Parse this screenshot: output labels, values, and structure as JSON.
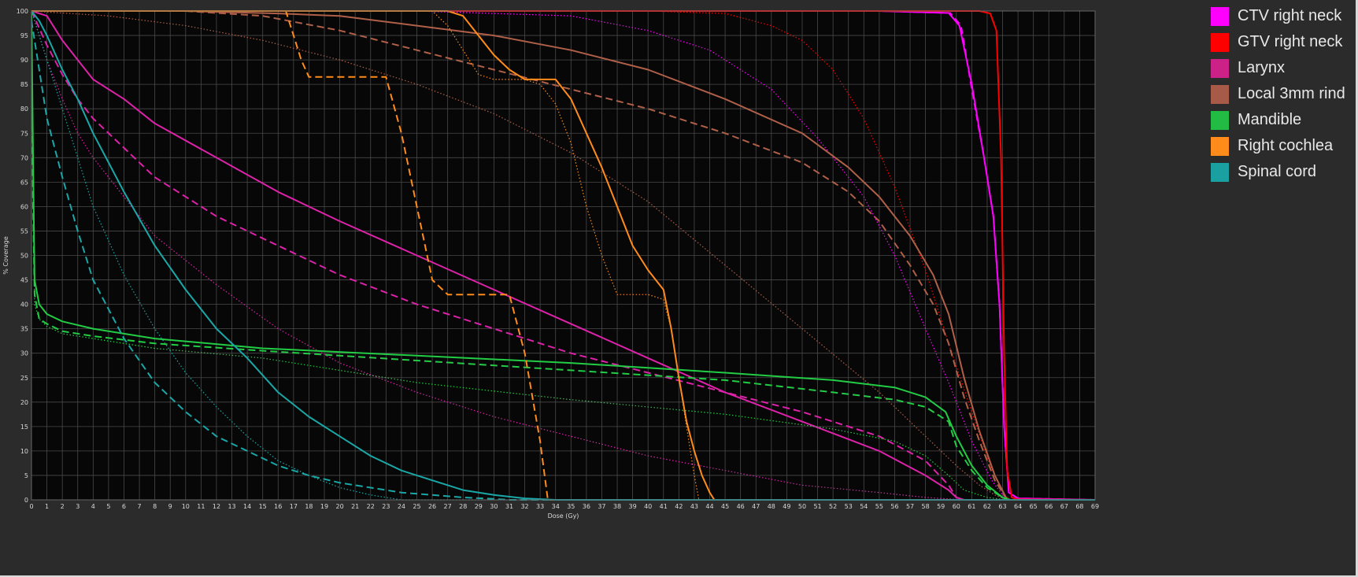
{
  "chart_data": {
    "type": "line",
    "title": "",
    "xlabel": "Dose (Gy)",
    "ylabel": "% Coverage",
    "xlim": [
      0,
      69
    ],
    "ylim": [
      0,
      100
    ],
    "x_ticks": [
      0,
      1,
      2,
      3,
      4,
      5,
      6,
      7,
      8,
      9,
      10,
      11,
      12,
      13,
      14,
      15,
      16,
      17,
      18,
      19,
      20,
      21,
      22,
      23,
      24,
      25,
      26,
      27,
      28,
      29,
      30,
      31,
      32,
      33,
      34,
      35,
      36,
      37,
      38,
      39,
      40,
      41,
      42,
      43,
      44,
      45,
      46,
      47,
      48,
      49,
      50,
      51,
      52,
      53,
      54,
      55,
      56,
      57,
      58,
      59,
      60,
      61,
      62,
      63,
      64,
      65,
      66,
      67,
      68,
      69
    ],
    "y_ticks": [
      0,
      5,
      10,
      15,
      20,
      25,
      30,
      35,
      40,
      45,
      50,
      55,
      60,
      65,
      70,
      75,
      80,
      85,
      90,
      95,
      100
    ],
    "grid": true,
    "legend_position": "right",
    "series": [
      {
        "name": "CTV right neck",
        "color": "#ff00ff",
        "style": "solid",
        "x": [
          0,
          55,
          59.5,
          60.2,
          61,
          61.8,
          62.4,
          62.8,
          63.1,
          63.4,
          64,
          69
        ],
        "y": [
          100,
          100,
          99.6,
          97,
          85,
          70,
          58,
          40,
          15,
          1.5,
          0.3,
          0
        ]
      },
      {
        "name": "CTV right neck",
        "color": "#ff00ff",
        "style": "dashed",
        "x": [
          0,
          55,
          59.6,
          60.3,
          61,
          61.8,
          62.4,
          62.8,
          63.1,
          63.4,
          64,
          69
        ],
        "y": [
          100,
          100,
          99.6,
          97,
          84,
          70,
          58,
          40,
          15,
          1.5,
          0.3,
          0
        ]
      },
      {
        "name": "CTV right neck",
        "color": "#ff00ff",
        "style": "dotted",
        "x": [
          0,
          25,
          35,
          40,
          44,
          48,
          51,
          54,
          56,
          58,
          59.5,
          61,
          62.3,
          63,
          63.5
        ],
        "y": [
          100,
          100,
          99,
          96,
          92,
          84,
          74,
          62,
          50,
          35,
          24,
          12,
          4,
          1,
          0
        ]
      },
      {
        "name": "GTV right neck",
        "color": "#ff0000",
        "style": "solid",
        "x": [
          0,
          60,
          61.5,
          62.2,
          62.6,
          62.9,
          63.1,
          63.3,
          63.6,
          64,
          69
        ],
        "y": [
          100,
          100,
          100,
          99.5,
          96,
          70,
          30,
          6,
          0.5,
          0.1,
          0
        ]
      },
      {
        "name": "GTV right neck",
        "color": "#ff0000",
        "style": "dotted",
        "x": [
          0,
          40,
          45,
          48,
          50,
          52,
          54,
          56,
          58,
          59.5,
          61,
          62.2,
          63,
          63.5
        ],
        "y": [
          100,
          100,
          99.5,
          97,
          94,
          88,
          78,
          64,
          47,
          32,
          18,
          7,
          1.5,
          0
        ]
      },
      {
        "name": "Larynx",
        "color": "#dd22aa",
        "style": "solid",
        "x": [
          0,
          1,
          2,
          3,
          4,
          6,
          8,
          12,
          16,
          20,
          25,
          30,
          35,
          40,
          45,
          50,
          55,
          58,
          59.5,
          60,
          60.5,
          69
        ],
        "y": [
          100,
          99,
          94,
          90,
          86,
          82,
          77,
          70,
          63,
          57,
          50,
          43,
          36,
          29,
          22,
          16,
          10,
          5,
          2,
          0.5,
          0,
          0
        ]
      },
      {
        "name": "Larynx",
        "color": "#dd22aa",
        "style": "dashed",
        "x": [
          0,
          1,
          2,
          3,
          4,
          6,
          8,
          12,
          16,
          20,
          25,
          30,
          35,
          40,
          45,
          50,
          55,
          58,
          59.5,
          60,
          60.5,
          69
        ],
        "y": [
          100,
          93,
          87,
          82,
          78,
          72,
          66,
          58,
          52,
          46,
          40,
          35,
          30,
          26,
          22,
          18,
          13,
          8,
          3,
          0.5,
          0,
          0
        ]
      },
      {
        "name": "Larynx",
        "color": "#dd22aa",
        "style": "dotted",
        "x": [
          0,
          1,
          2,
          3,
          4,
          6,
          8,
          12,
          16,
          20,
          25,
          30,
          35,
          40,
          45,
          50,
          55,
          58,
          60,
          61
        ],
        "y": [
          100,
          90,
          82,
          75,
          70,
          62,
          54,
          44,
          35,
          28,
          22,
          17,
          13,
          9,
          6,
          3,
          1.5,
          0.5,
          0.1,
          0
        ]
      },
      {
        "name": "Local 3mm rind",
        "color": "#b06048",
        "style": "solid",
        "x": [
          0,
          10,
          16,
          20,
          25,
          30,
          35,
          40,
          45,
          50,
          53,
          55,
          57,
          58.5,
          59.5,
          60.5,
          61.5,
          62.5,
          63.3
        ],
        "y": [
          100,
          100,
          99.5,
          99,
          97,
          95,
          92,
          88,
          82,
          75,
          68,
          62,
          54,
          46,
          38,
          25,
          14,
          5,
          0
        ]
      },
      {
        "name": "Local 3mm rind",
        "color": "#b06048",
        "style": "dashed",
        "x": [
          0,
          10,
          15,
          20,
          25,
          30,
          35,
          40,
          45,
          50,
          53,
          55,
          57,
          58.5,
          59.5,
          60.5,
          61.5,
          62.5,
          63.3
        ],
        "y": [
          100,
          100,
          99,
          96,
          92,
          88,
          84,
          80,
          75,
          69,
          63,
          57,
          48,
          40,
          32,
          21,
          12,
          4,
          0
        ]
      },
      {
        "name": "Local 3mm rind",
        "color": "#b06048",
        "style": "dotted",
        "x": [
          0,
          5,
          10,
          15,
          20,
          25,
          30,
          35,
          40,
          45,
          50,
          55,
          58,
          60,
          61.5,
          62.5,
          63.3
        ],
        "y": [
          100,
          99,
          97,
          94,
          90,
          85,
          79,
          71,
          61,
          48,
          35,
          22,
          13,
          7,
          3,
          1,
          0
        ]
      },
      {
        "name": "Mandible",
        "color": "#22cc44",
        "style": "solid",
        "x": [
          0,
          0.1,
          0.2,
          0.5,
          1,
          2,
          4,
          8,
          15,
          25,
          35,
          45,
          52,
          56,
          58,
          59.3,
          60,
          61,
          62,
          63,
          63.5,
          69
        ],
        "y": [
          100,
          70,
          45,
          40,
          38,
          36.5,
          35,
          33,
          31,
          29.5,
          28,
          26,
          24.5,
          23,
          21,
          18,
          13,
          7,
          3,
          0.5,
          0,
          0
        ]
      },
      {
        "name": "Mandible",
        "color": "#22cc44",
        "style": "dashed",
        "x": [
          0,
          0.1,
          0.2,
          0.5,
          1,
          2,
          4,
          8,
          15,
          25,
          35,
          45,
          52,
          56,
          58,
          59.5,
          60,
          61,
          62,
          63,
          63.5,
          69
        ],
        "y": [
          97,
          60,
          42,
          37,
          36,
          34.5,
          33.5,
          32,
          30.5,
          28.5,
          26.5,
          24.5,
          22,
          20.5,
          19,
          16,
          11,
          6,
          2.5,
          0.5,
          0,
          0
        ]
      },
      {
        "name": "Mandible",
        "color": "#22cc44",
        "style": "dotted",
        "x": [
          0,
          0.2,
          0.5,
          1,
          2,
          4,
          8,
          15,
          25,
          35,
          45,
          52,
          56,
          58,
          59.5,
          60.5,
          62,
          63,
          63.5
        ],
        "y": [
          96,
          40,
          37,
          35.5,
          34,
          33,
          31,
          29,
          24,
          20.5,
          17.5,
          14.5,
          12,
          9,
          5,
          2,
          0.5,
          0.1,
          0
        ]
      },
      {
        "name": "Right cochlea",
        "color": "#ff8c1a",
        "style": "solid",
        "x": [
          0,
          27,
          28,
          29,
          30,
          31,
          32,
          33,
          34,
          35,
          36,
          37,
          38,
          39,
          40,
          40.5,
          41,
          41.5,
          42,
          42.5,
          43,
          43.5,
          44,
          44.3,
          69
        ],
        "y": [
          100,
          100,
          99,
          95,
          91,
          88,
          86,
          86,
          86,
          82,
          75,
          68,
          60,
          52,
          47,
          45,
          43,
          35,
          25,
          16,
          10,
          5,
          1.5,
          0,
          0
        ]
      },
      {
        "name": "Right cochlea",
        "color": "#ff8c1a",
        "style": "dashed",
        "x": [
          0,
          16.5,
          17,
          17.5,
          18,
          19,
          20,
          21,
          22,
          23,
          24,
          25,
          26,
          27,
          28,
          29,
          30,
          31,
          32,
          33,
          33.5,
          69
        ],
        "y": [
          100,
          100,
          95,
          90,
          86.5,
          86.5,
          86.5,
          86.5,
          86.5,
          86.5,
          75,
          60,
          45,
          42,
          42,
          42,
          42,
          42,
          30,
          12,
          0,
          0
        ]
      },
      {
        "name": "Right cochlea",
        "color": "#ff8c1a",
        "style": "dotted",
        "x": [
          0,
          26,
          27,
          28,
          29,
          30,
          31,
          32,
          33,
          34,
          35,
          36,
          37,
          38,
          39,
          40,
          41,
          41.5,
          42,
          42.5,
          43,
          43.3,
          69
        ],
        "y": [
          100,
          100,
          97,
          92,
          87,
          86,
          86,
          86,
          85,
          81,
          73,
          60,
          50,
          42,
          42,
          42,
          41,
          35,
          25,
          15,
          5,
          0,
          0
        ]
      }
    ],
    "series_more": [
      {
        "name": "Spinal cord",
        "color": "#1aa7a7",
        "style": "solid",
        "x": [
          0,
          0.5,
          1,
          2,
          3,
          4,
          6,
          8,
          10,
          12,
          14,
          16,
          18,
          20,
          22,
          24,
          26,
          28,
          30,
          32,
          34,
          69
        ],
        "y": [
          100,
          98,
          95,
          88,
          82,
          75,
          63,
          52,
          43,
          35,
          29,
          22,
          17,
          13,
          9,
          6,
          4,
          2,
          1,
          0.3,
          0,
          0
        ]
      },
      {
        "name": "Spinal cord",
        "color": "#1aa7a7",
        "style": "dashed",
        "x": [
          0,
          0.5,
          1,
          2,
          3,
          4,
          6,
          8,
          10,
          12,
          14,
          16,
          18,
          20,
          22,
          24,
          26,
          28,
          30,
          31,
          69
        ],
        "y": [
          98,
          88,
          78,
          66,
          55,
          45,
          33,
          24,
          18,
          13,
          10,
          7,
          5,
          3.5,
          2.5,
          1.5,
          1,
          0.5,
          0.2,
          0,
          0
        ]
      },
      {
        "name": "Spinal cord",
        "color": "#1aa7a7",
        "style": "dotted",
        "x": [
          0,
          0.5,
          1,
          2,
          3,
          4,
          6,
          8,
          10,
          12,
          14,
          16,
          18,
          20,
          22,
          24,
          69
        ],
        "y": [
          100,
          95,
          90,
          80,
          70,
          60,
          46,
          35,
          26,
          19,
          13,
          8,
          5,
          2.5,
          1,
          0,
          0
        ]
      }
    ]
  },
  "legend": {
    "items": [
      {
        "label": "CTV right neck",
        "color": "#ff00ff"
      },
      {
        "label": "GTV right neck",
        "color": "#ff0000"
      },
      {
        "label": "Larynx",
        "color": "#cc2288"
      },
      {
        "label": "Local 3mm rind",
        "color": "#a85a48"
      },
      {
        "label": "Mandible",
        "color": "#22bb44"
      },
      {
        "label": "Right cochlea",
        "color": "#ff8c1a"
      },
      {
        "label": "Spinal cord",
        "color": "#1aa0a0"
      }
    ]
  },
  "colors": {
    "plot_background": "#070707",
    "grid": "#4a4a4a",
    "panel_background": "#2b2b2b"
  }
}
